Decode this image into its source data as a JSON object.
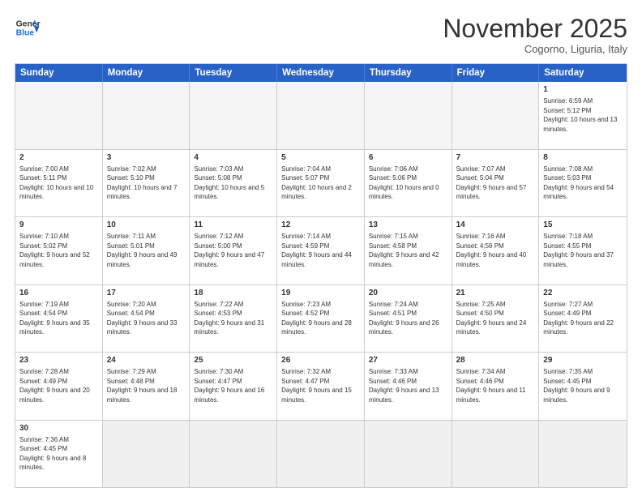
{
  "header": {
    "logo_general": "General",
    "logo_blue": "Blue",
    "month_title": "November 2025",
    "location": "Cogorno, Liguria, Italy"
  },
  "weekdays": [
    "Sunday",
    "Monday",
    "Tuesday",
    "Wednesday",
    "Thursday",
    "Friday",
    "Saturday"
  ],
  "rows": [
    [
      {
        "day": "",
        "info": ""
      },
      {
        "day": "",
        "info": ""
      },
      {
        "day": "",
        "info": ""
      },
      {
        "day": "",
        "info": ""
      },
      {
        "day": "",
        "info": ""
      },
      {
        "day": "",
        "info": ""
      },
      {
        "day": "1",
        "info": "Sunrise: 6:59 AM\nSunset: 5:12 PM\nDaylight: 10 hours and 13 minutes."
      }
    ],
    [
      {
        "day": "2",
        "info": "Sunrise: 7:00 AM\nSunset: 5:11 PM\nDaylight: 10 hours and 10 minutes."
      },
      {
        "day": "3",
        "info": "Sunrise: 7:02 AM\nSunset: 5:10 PM\nDaylight: 10 hours and 7 minutes."
      },
      {
        "day": "4",
        "info": "Sunrise: 7:03 AM\nSunset: 5:08 PM\nDaylight: 10 hours and 5 minutes."
      },
      {
        "day": "5",
        "info": "Sunrise: 7:04 AM\nSunset: 5:07 PM\nDaylight: 10 hours and 2 minutes."
      },
      {
        "day": "6",
        "info": "Sunrise: 7:06 AM\nSunset: 5:06 PM\nDaylight: 10 hours and 0 minutes."
      },
      {
        "day": "7",
        "info": "Sunrise: 7:07 AM\nSunset: 5:04 PM\nDaylight: 9 hours and 57 minutes."
      },
      {
        "day": "8",
        "info": "Sunrise: 7:08 AM\nSunset: 5:03 PM\nDaylight: 9 hours and 54 minutes."
      }
    ],
    [
      {
        "day": "9",
        "info": "Sunrise: 7:10 AM\nSunset: 5:02 PM\nDaylight: 9 hours and 52 minutes."
      },
      {
        "day": "10",
        "info": "Sunrise: 7:11 AM\nSunset: 5:01 PM\nDaylight: 9 hours and 49 minutes."
      },
      {
        "day": "11",
        "info": "Sunrise: 7:12 AM\nSunset: 5:00 PM\nDaylight: 9 hours and 47 minutes."
      },
      {
        "day": "12",
        "info": "Sunrise: 7:14 AM\nSunset: 4:59 PM\nDaylight: 9 hours and 44 minutes."
      },
      {
        "day": "13",
        "info": "Sunrise: 7:15 AM\nSunset: 4:58 PM\nDaylight: 9 hours and 42 minutes."
      },
      {
        "day": "14",
        "info": "Sunrise: 7:16 AM\nSunset: 4:56 PM\nDaylight: 9 hours and 40 minutes."
      },
      {
        "day": "15",
        "info": "Sunrise: 7:18 AM\nSunset: 4:55 PM\nDaylight: 9 hours and 37 minutes."
      }
    ],
    [
      {
        "day": "16",
        "info": "Sunrise: 7:19 AM\nSunset: 4:54 PM\nDaylight: 9 hours and 35 minutes."
      },
      {
        "day": "17",
        "info": "Sunrise: 7:20 AM\nSunset: 4:54 PM\nDaylight: 9 hours and 33 minutes."
      },
      {
        "day": "18",
        "info": "Sunrise: 7:22 AM\nSunset: 4:53 PM\nDaylight: 9 hours and 31 minutes."
      },
      {
        "day": "19",
        "info": "Sunrise: 7:23 AM\nSunset: 4:52 PM\nDaylight: 9 hours and 28 minutes."
      },
      {
        "day": "20",
        "info": "Sunrise: 7:24 AM\nSunset: 4:51 PM\nDaylight: 9 hours and 26 minutes."
      },
      {
        "day": "21",
        "info": "Sunrise: 7:25 AM\nSunset: 4:50 PM\nDaylight: 9 hours and 24 minutes."
      },
      {
        "day": "22",
        "info": "Sunrise: 7:27 AM\nSunset: 4:49 PM\nDaylight: 9 hours and 22 minutes."
      }
    ],
    [
      {
        "day": "23",
        "info": "Sunrise: 7:28 AM\nSunset: 4:49 PM\nDaylight: 9 hours and 20 minutes."
      },
      {
        "day": "24",
        "info": "Sunrise: 7:29 AM\nSunset: 4:48 PM\nDaylight: 9 hours and 18 minutes."
      },
      {
        "day": "25",
        "info": "Sunrise: 7:30 AM\nSunset: 4:47 PM\nDaylight: 9 hours and 16 minutes."
      },
      {
        "day": "26",
        "info": "Sunrise: 7:32 AM\nSunset: 4:47 PM\nDaylight: 9 hours and 15 minutes."
      },
      {
        "day": "27",
        "info": "Sunrise: 7:33 AM\nSunset: 4:46 PM\nDaylight: 9 hours and 13 minutes."
      },
      {
        "day": "28",
        "info": "Sunrise: 7:34 AM\nSunset: 4:46 PM\nDaylight: 9 hours and 11 minutes."
      },
      {
        "day": "29",
        "info": "Sunrise: 7:35 AM\nSunset: 4:45 PM\nDaylight: 9 hours and 9 minutes."
      }
    ],
    [
      {
        "day": "30",
        "info": "Sunrise: 7:36 AM\nSunset: 4:45 PM\nDaylight: 9 hours and 8 minutes."
      },
      {
        "day": "",
        "info": ""
      },
      {
        "day": "",
        "info": ""
      },
      {
        "day": "",
        "info": ""
      },
      {
        "day": "",
        "info": ""
      },
      {
        "day": "",
        "info": ""
      },
      {
        "day": "",
        "info": ""
      }
    ]
  ]
}
